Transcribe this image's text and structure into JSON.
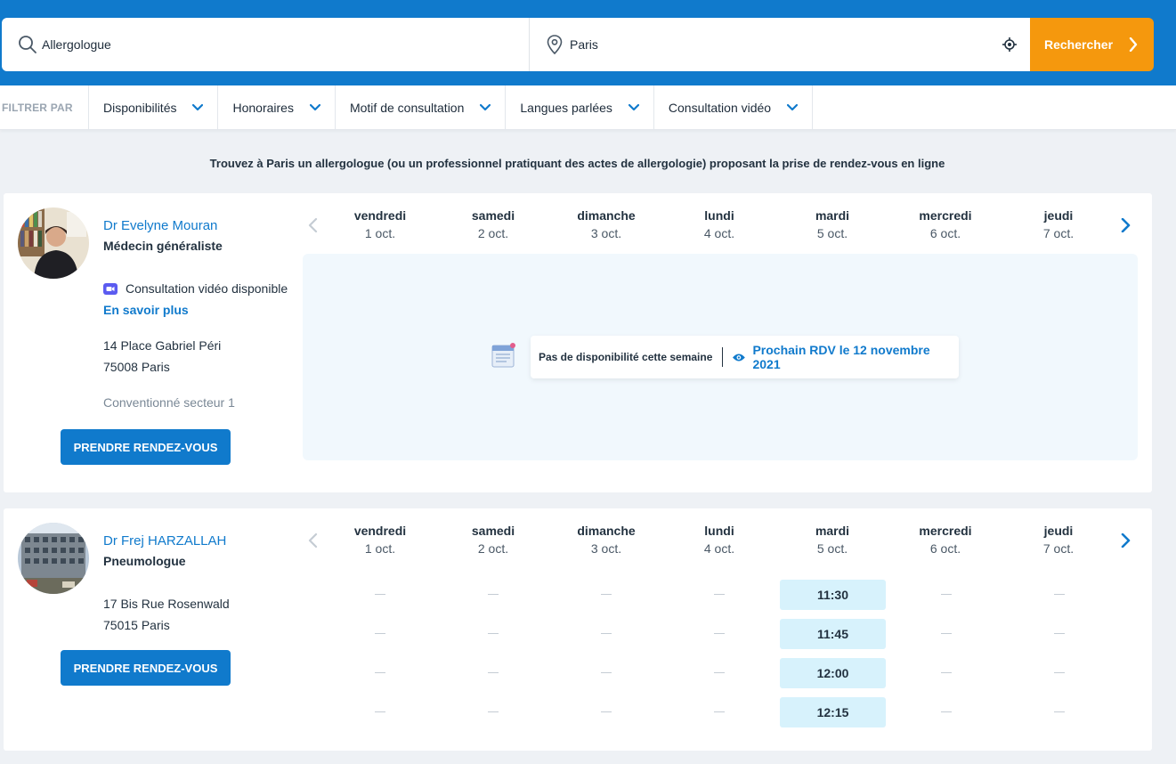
{
  "search": {
    "specialty_value": "Allergologue",
    "location_value": "Paris",
    "button_label": "Rechercher"
  },
  "filters": {
    "label": "FILTRER PAR",
    "items": [
      "Disponibilités",
      "Honoraires",
      "Motif de consultation",
      "Langues parlées",
      "Consultation vidéo"
    ]
  },
  "headline": "Trouvez à Paris un allergologue (ou un professionnel pratiquant des actes de allergologie) proposant la prise de rendez-vous en ligne",
  "days": [
    {
      "name": "vendredi",
      "date": "1 oct."
    },
    {
      "name": "samedi",
      "date": "2 oct."
    },
    {
      "name": "dimanche",
      "date": "3 oct."
    },
    {
      "name": "lundi",
      "date": "4 oct."
    },
    {
      "name": "mardi",
      "date": "5 oct."
    },
    {
      "name": "mercredi",
      "date": "6 oct."
    },
    {
      "name": "jeudi",
      "date": "7 oct."
    }
  ],
  "doctors": [
    {
      "name": "Dr Evelyne Mouran",
      "specialty": "Médecin généraliste",
      "video_label": "Consultation vidéo disponible",
      "learn_more": "En savoir plus",
      "address_line1": "14 Place Gabriel Péri",
      "address_line2": "75008 Paris",
      "sector": "Conventionné secteur 1",
      "book_label": "PRENDRE RENDEZ-VOUS",
      "no_availability": "Pas de disponibilité cette semaine",
      "next_appointment": "Prochain RDV le 12 novembre 2021"
    },
    {
      "name": "Dr Frej HARZALLAH",
      "specialty": "Pneumologue",
      "address_line1": "17 Bis Rue Rosenwald",
      "address_line2": "75015 Paris",
      "book_label": "PRENDRE RENDEZ-VOUS",
      "slots": [
        "11:30",
        "11:45",
        "12:00",
        "12:15"
      ],
      "slots_day": "mardi 5 oct."
    }
  ],
  "colors": {
    "brand_blue": "#107acc",
    "orange": "#f5980d",
    "slot_bg": "#d7f2fc",
    "page_bg": "#eef1f5"
  }
}
